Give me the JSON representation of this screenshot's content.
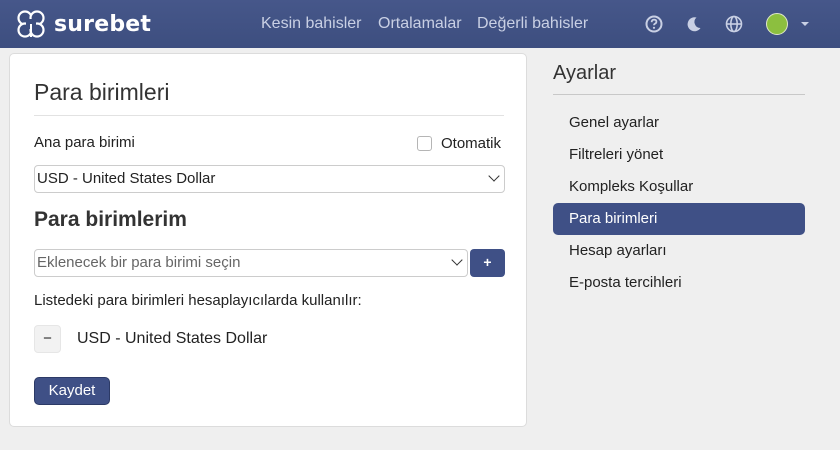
{
  "brand": {
    "name": "surebet",
    "logo_icon": "clover-icon"
  },
  "nav": {
    "links": [
      "Kesin bahisler",
      "Ortalamalar",
      "Değerli bahisler"
    ],
    "icons": [
      "help-icon",
      "moon-icon",
      "globe-icon"
    ]
  },
  "main": {
    "title": "Para birimleri",
    "base_currency_label": "Ana para birimi",
    "automatic_label": "Otomatik",
    "automatic_checked": false,
    "base_currency_value": "USD - United States Dollar",
    "my_currencies_title": "Para birimlerim",
    "add_placeholder": "Eklenecek bir para birimi seçin",
    "add_button": "+",
    "info_text": "Listedeki para birimleri hesaplayıcılarda kullanılır:",
    "currencies": [
      {
        "remove": "−",
        "name": "USD - United States Dollar"
      }
    ],
    "save_button": "Kaydet"
  },
  "sidebar": {
    "title": "Ayarlar",
    "active_index": 3,
    "items": [
      {
        "label": "Genel ayarlar"
      },
      {
        "label": "Filtreleri yönet"
      },
      {
        "label": "Kompleks Koşullar"
      },
      {
        "label": "Para birimleri"
      },
      {
        "label": "Hesap ayarları"
      },
      {
        "label": "E-posta tercihleri"
      }
    ]
  },
  "colors": {
    "navbar": "#3d4e7f",
    "accent": "#3f5086",
    "page_bg": "#efefef"
  }
}
